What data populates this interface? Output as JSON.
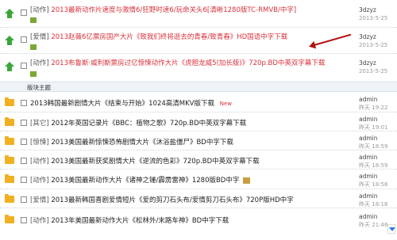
{
  "colors": {
    "red_title": "#d9303a",
    "link_blue": "#2a7ae2",
    "sticky_arrow": "#3aa63a",
    "folder": "#f0b020",
    "annotation": "#b01010"
  },
  "sticky_threads": [
    {
      "tag": "[动作]",
      "title": "2013最新动作片速度与激情6/狂野时速6/玩命关头6[清晰1280版TC-RMVB/中字]",
      "author": "3dzyz",
      "date": "2013-5-25"
    },
    {
      "tag": "[爱情]",
      "title": "2013赵薇6亿票房国产大片《致我们终将逝去的青春/致青春》HD国语中字下载",
      "author": "3dzyz",
      "date": "2013-5-25"
    },
    {
      "tag": "[动作]",
      "title": "2013布鲁斯·威利斯票房过亿惊悚动作大片《虎胆龙威5(加长版)》720p.BD中英双字幕下载",
      "author": "3dzyz",
      "date": "2013-5-25"
    }
  ],
  "divider_label": "版块主题",
  "threads": [
    {
      "tag": "",
      "title": "2013韩国最新剧情大片《结束与开始》1024高清MKV版下载",
      "new_label": "New",
      "author": "admin",
      "date": "昨天",
      "time": "19:22",
      "icon": "folder-icon"
    },
    {
      "tag": "[其它]",
      "title": "2012年英国记录片《BBC：植物之歌》720p.BD中英双字幕下载",
      "author": "admin",
      "date": "昨天",
      "time": "19:01"
    },
    {
      "tag": "[惊悚]",
      "title": "2013美国最新惊悚恐怖剧情大片《沐浴盐僵尸》BD中字下载",
      "author": "admin",
      "date": "昨天",
      "time": "18:59"
    },
    {
      "tag": "[动作]",
      "title": "2013美国最新获奖剧情大片《逆流的色彩》720p.BD中英双字幕下载",
      "author": "admin",
      "date": "昨天",
      "time": "18:59"
    },
    {
      "tag": "[动作]",
      "title": "2013美国最新动作大片《诸神之锤/霹雳雷神》1280版BD中字",
      "author": "admin",
      "date": "昨天",
      "time": "18:56"
    },
    {
      "tag": "[爱情]",
      "title": "2013最新韩国喜剧爱情短片《爱的剪刀石头布/爱情剪刀石头布》720P版HD中字",
      "author": "admin",
      "date": "昨天",
      "time": "18:16"
    },
    {
      "tag": "[动作]",
      "title": "2013年美国最新动作大片《松林外/末路车神》BD中字下载",
      "author": "admin",
      "date": "昨天",
      "time": "21:46"
    }
  ]
}
